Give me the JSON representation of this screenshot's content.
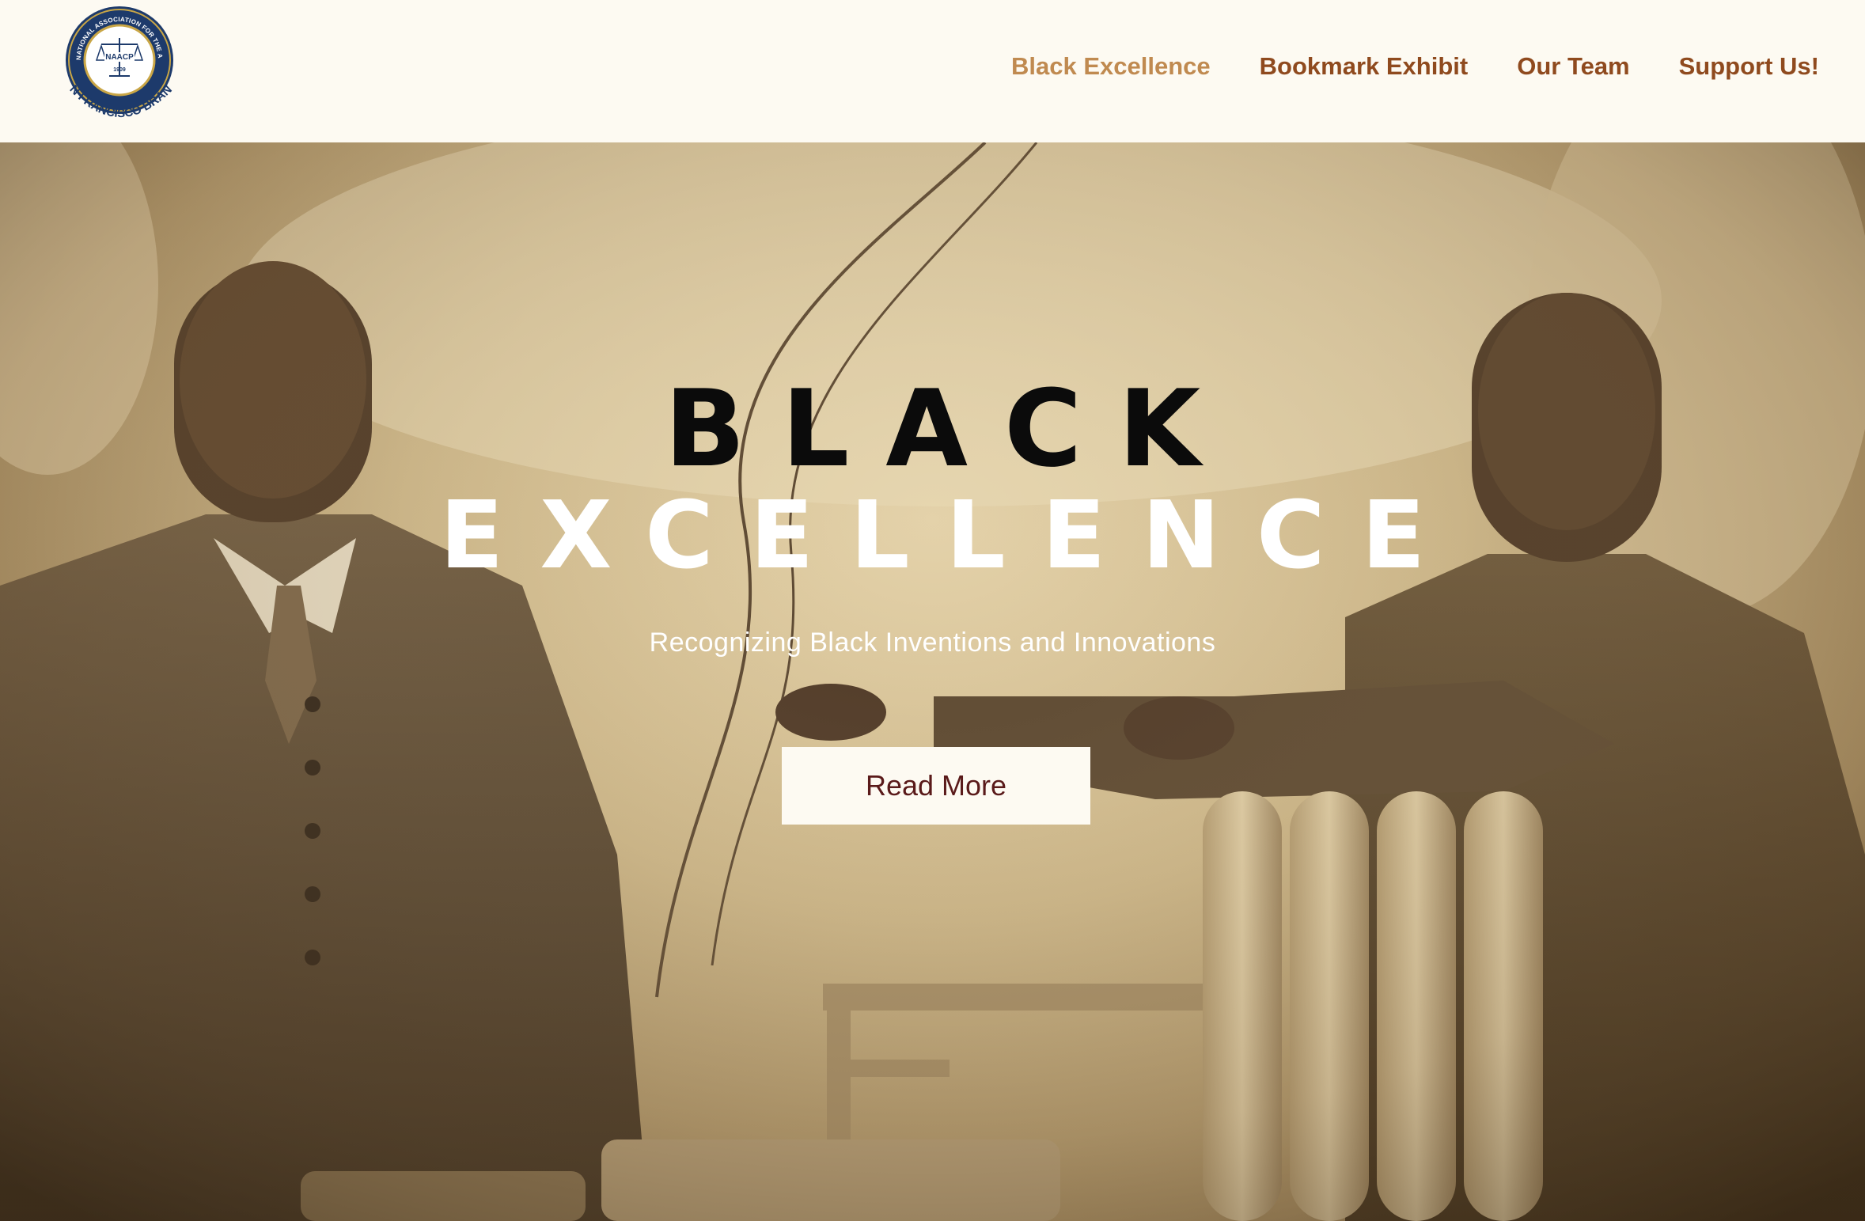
{
  "header": {
    "logo": {
      "ring_text_top": "NATIONAL ASSOCIATION FOR THE ADVANCEMENT OF COLORED PEOPLE",
      "ring_text_bottom": "SAN FRANCISCO BRANCH",
      "center_text": "NAACP",
      "founded": "1909"
    },
    "nav": [
      {
        "label": "Black Excellence",
        "active": true
      },
      {
        "label": "Bookmark Exhibit",
        "active": false
      },
      {
        "label": "Our Team",
        "active": false
      },
      {
        "label": "Support Us!",
        "active": false
      }
    ]
  },
  "hero": {
    "title_line1": "BLACK",
    "title_line2": "EXCELLENCE",
    "subtitle": "Recognizing Black Inventions and Innovations",
    "button_label": "Read More",
    "background": "sepia-photo-two-men-with-radiator"
  },
  "colors": {
    "header_bg": "#fdfaf2",
    "nav_text": "#8f4a1e",
    "nav_active": "#c08a50",
    "logo_navy": "#1d3a6b",
    "logo_gold": "#c9a646",
    "button_bg": "#fdfaf2",
    "button_text": "#5a1a1a"
  }
}
